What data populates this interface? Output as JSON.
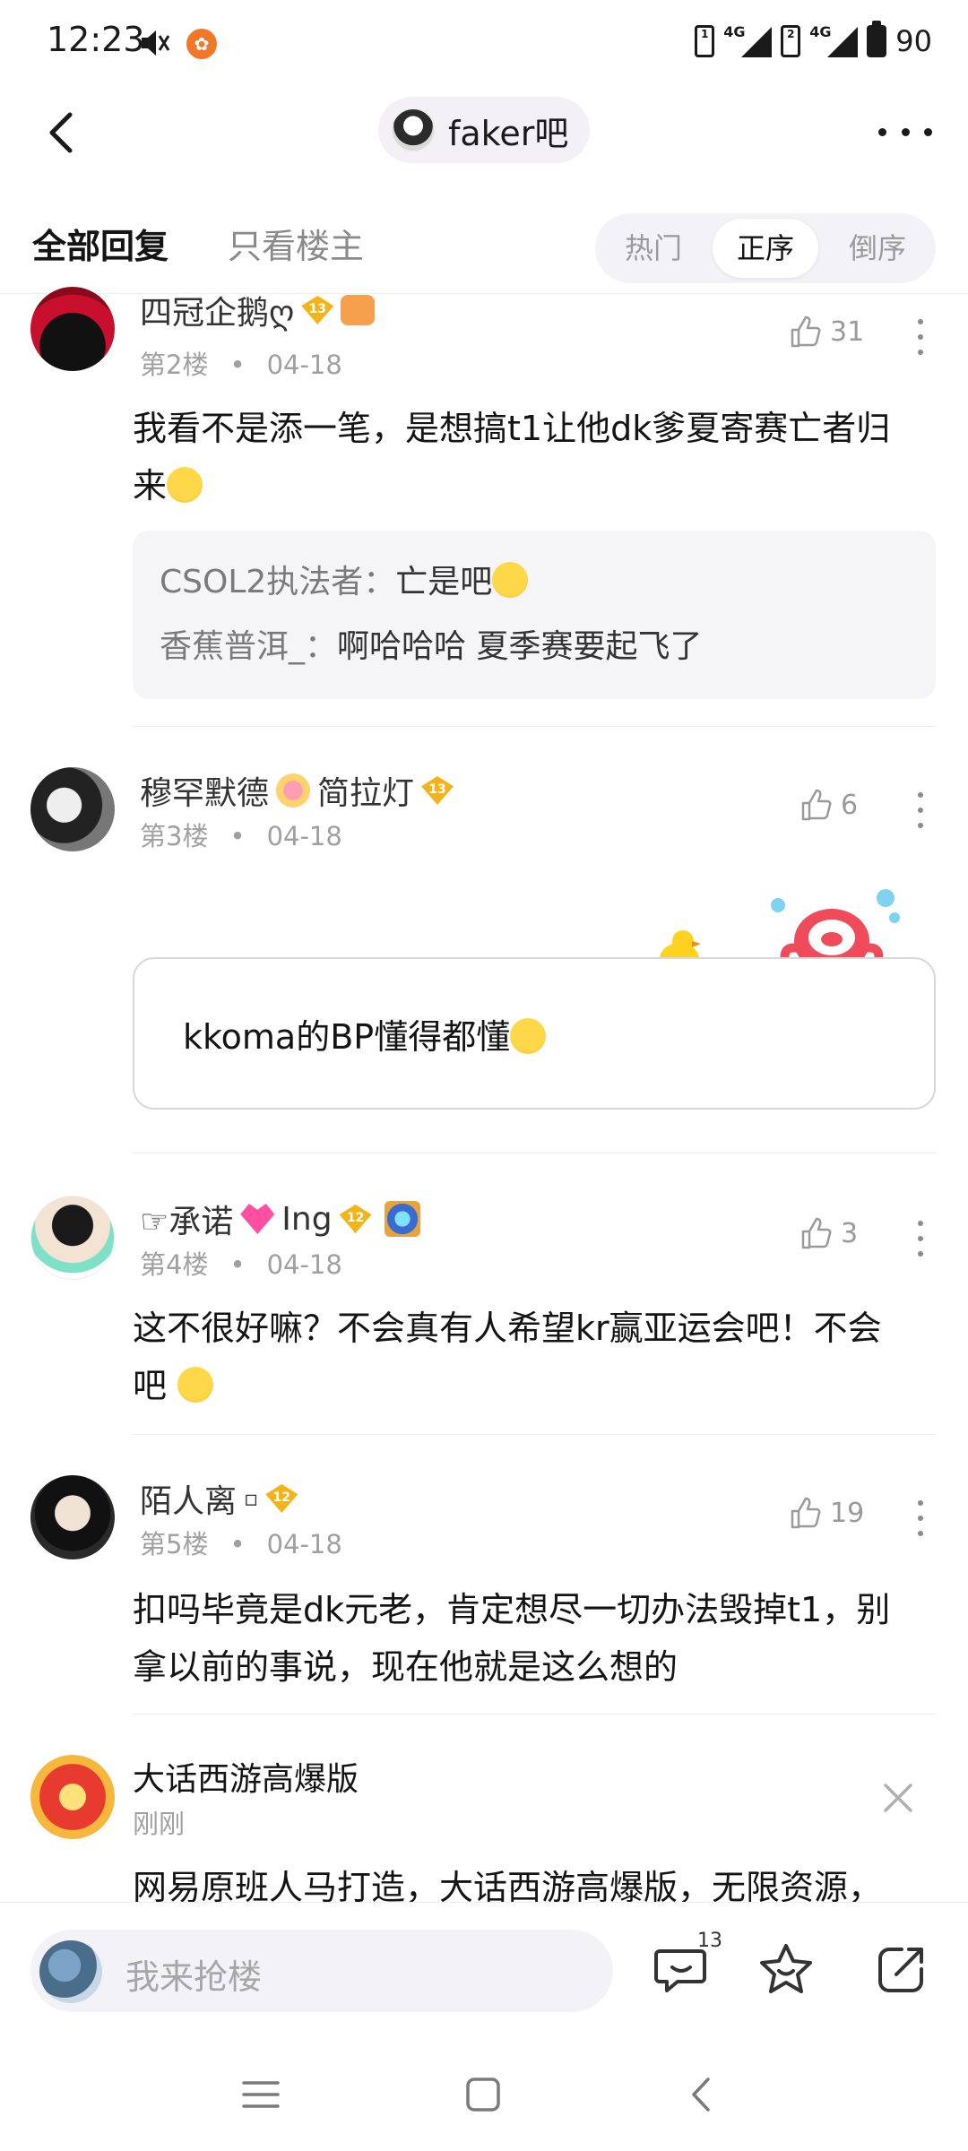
{
  "status": {
    "time": "12:23",
    "battery": "90",
    "network1": "4G",
    "network2": "4G"
  },
  "nav": {
    "forum_name": "faker吧"
  },
  "filter": {
    "tab_all": "全部回复",
    "tab_owner": "只看楼主",
    "sort_hot": "热门",
    "sort_asc": "正序",
    "sort_desc": "倒序",
    "active_sort": "正序"
  },
  "posts": [
    {
      "user": "四冠企鹅ღ",
      "badge_level": "13",
      "floor": "第2楼",
      "date": "04-18",
      "likes": "31",
      "content_line1": "我看不是添一笔，是想搞t1让他dk爹夏寄赛亡者归",
      "content_line2": "来",
      "replies": [
        {
          "user": "CSOL2执法者：",
          "text": "亡是吧"
        },
        {
          "user": "香蕉普洱_：",
          "text": "啊哈哈哈 夏季赛要起飞了"
        }
      ]
    },
    {
      "user": "穆罕默德",
      "user_suffix": "简拉灯",
      "badge_level": "13",
      "floor": "第3楼",
      "date": "04-18",
      "likes": "6",
      "content": "kkoma的BP懂得都懂"
    },
    {
      "user": "☞承诺",
      "user_suffix": "Ing",
      "badge_level": "12",
      "floor": "第4楼",
      "date": "04-18",
      "likes": "3",
      "content_line1": "这不很好嘛？不会真有人希望kr赢亚运会吧！不会",
      "content_line2": "吧"
    },
    {
      "user": "陌人离",
      "user_suffix": "▫",
      "badge_level": "12",
      "floor": "第5楼",
      "date": "04-18",
      "likes": "19",
      "content_line1": "扣吗毕竟是dk元老，肯定想尽一切办法毁掉t1，别",
      "content_line2": "拿以前的事说，现在他就是这么想的"
    }
  ],
  "ad": {
    "title": "大话西游高爆版",
    "time": "刚刚",
    "text": "网易原班人马打造，大话西游高爆版，无限资源，"
  },
  "bottom": {
    "placeholder": "我来抢楼",
    "comment_count": "13"
  },
  "icons": [
    "mute-icon",
    "back-icon",
    "more-icon",
    "like-icon",
    "kebab-icon",
    "close-icon",
    "comment-icon",
    "star-icon",
    "share-icon",
    "menu-icon",
    "home-icon",
    "back-nav-icon"
  ]
}
